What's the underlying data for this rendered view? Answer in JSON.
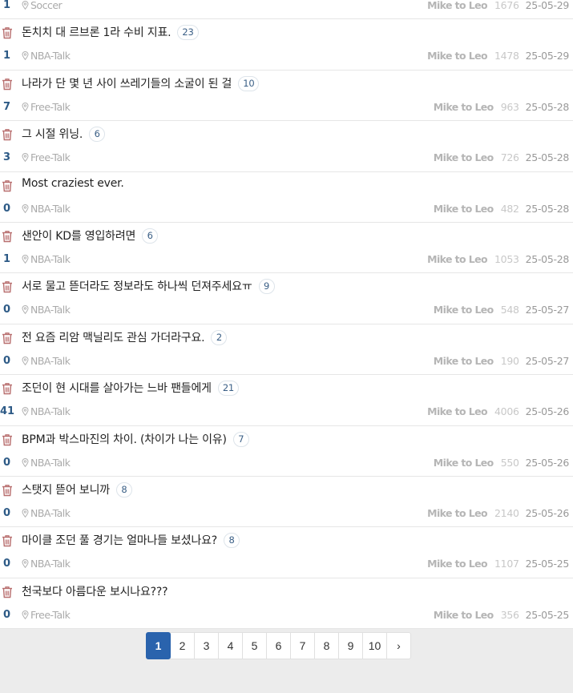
{
  "posts": [
    {
      "title": "",
      "comments": "",
      "votes": "1",
      "category": "Soccer",
      "author": "Mike to Leo",
      "views": "1676",
      "date": "25-05-29"
    },
    {
      "title": "돈치치 대 르브론 1라 수비 지표.",
      "comments": "23",
      "votes": "1",
      "category": "NBA-Talk",
      "author": "Mike to Leo",
      "views": "1478",
      "date": "25-05-29"
    },
    {
      "title": "나라가 단 몇 년 사이 쓰레기들의 소굴이 된 걸",
      "comments": "10",
      "votes": "7",
      "category": "Free-Talk",
      "author": "Mike to Leo",
      "views": "963",
      "date": "25-05-28"
    },
    {
      "title": "그 시절 위닝.",
      "comments": "6",
      "votes": "3",
      "category": "Free-Talk",
      "author": "Mike to Leo",
      "views": "726",
      "date": "25-05-28"
    },
    {
      "title": "Most craziest ever.",
      "comments": "",
      "votes": "0",
      "category": "NBA-Talk",
      "author": "Mike to Leo",
      "views": "482",
      "date": "25-05-28"
    },
    {
      "title": "샌안이 KD를 영입하려면",
      "comments": "6",
      "votes": "1",
      "category": "NBA-Talk",
      "author": "Mike to Leo",
      "views": "1053",
      "date": "25-05-28"
    },
    {
      "title": "서로 물고 뜯더라도 정보라도 하나씩 던져주세요ㅠ",
      "comments": "9",
      "votes": "0",
      "category": "NBA-Talk",
      "author": "Mike to Leo",
      "views": "548",
      "date": "25-05-27"
    },
    {
      "title": "전 요즘 리암 맥닐리도 관심 가더라구요.",
      "comments": "2",
      "votes": "0",
      "category": "NBA-Talk",
      "author": "Mike to Leo",
      "views": "190",
      "date": "25-05-27"
    },
    {
      "title": "조던이 현 시대를 살아가는 느바 팬들에게",
      "comments": "21",
      "votes": "41",
      "category": "NBA-Talk",
      "author": "Mike to Leo",
      "views": "4006",
      "date": "25-05-26"
    },
    {
      "title": "BPM과 박스마진의 차이. (차이가 나는 이유)",
      "comments": "7",
      "votes": "0",
      "category": "NBA-Talk",
      "author": "Mike to Leo",
      "views": "550",
      "date": "25-05-26"
    },
    {
      "title": "스탯지 뜯어 보니까",
      "comments": "8",
      "votes": "0",
      "category": "NBA-Talk",
      "author": "Mike to Leo",
      "views": "2140",
      "date": "25-05-26"
    },
    {
      "title": "마이클 조던 풀 경기는 얼마나들 보셨나요?",
      "comments": "8",
      "votes": "0",
      "category": "NBA-Talk",
      "author": "Mike to Leo",
      "views": "1107",
      "date": "25-05-25"
    },
    {
      "title": "천국보다 아름다운 보시나요???",
      "comments": "",
      "votes": "0",
      "category": "Free-Talk",
      "author": "Mike to Leo",
      "views": "356",
      "date": "25-05-25"
    }
  ],
  "pagination": {
    "pages": [
      "1",
      "2",
      "3",
      "4",
      "5",
      "6",
      "7",
      "8",
      "9",
      "10"
    ],
    "current": "1",
    "next": "›"
  },
  "colors": {
    "accent": "#2a63ad",
    "vote": "#2d5a86",
    "trash": "#b86e6e"
  },
  "icons": {
    "delete": "trash-icon",
    "category": "location-pin-icon",
    "next": "chevron-right-icon"
  }
}
